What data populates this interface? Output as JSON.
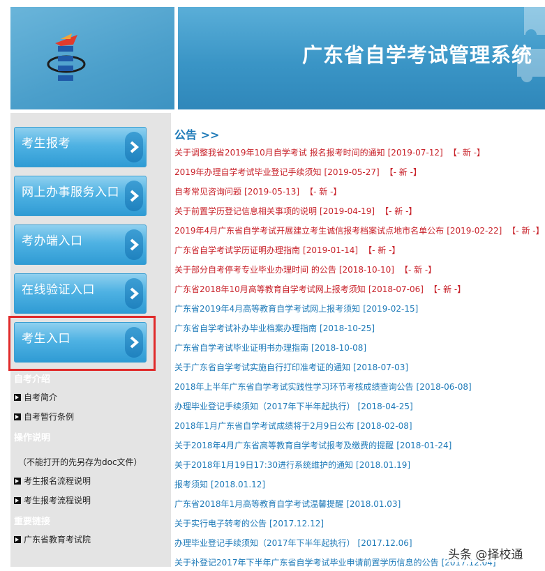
{
  "header": {
    "site_title": "广东省自学考试管理系统"
  },
  "nav": {
    "buttons": [
      {
        "label": "考生报考"
      },
      {
        "label": "网上办事服务入口"
      },
      {
        "label": "考办端入口"
      },
      {
        "label": "在线验证入口"
      },
      {
        "label": "考生入口"
      }
    ]
  },
  "sidebar": {
    "sections": [
      {
        "heading": "自考介绍",
        "links": [
          "自考简介",
          "自考暂行条例"
        ]
      },
      {
        "heading": "操作说明",
        "note": "（不能打开的先另存为doc文件）",
        "links": [
          "考生报名流程说明",
          "考生报考流程说明"
        ]
      },
      {
        "heading": "重要链接",
        "links": [
          "广东省教育考试院"
        ]
      }
    ]
  },
  "notices": {
    "title": "公告 >>",
    "new_tag": "【- 新 -】",
    "items": [
      {
        "text": "关于调整我省2019年10月自学考试 报名报考时间的通知",
        "date": "[2019-07-12]",
        "is_new": true
      },
      {
        "text": "2019年办理自学考试毕业登记手续须知",
        "date": "[2019-05-27]",
        "is_new": true
      },
      {
        "text": "自考常见咨询问题",
        "date": "[2019-05-13]",
        "is_new": true
      },
      {
        "text": "关于前置学历登记信息相关事项的说明",
        "date": "[2019-04-19]",
        "is_new": true
      },
      {
        "text": "2019年4月广东省自学考试开展建立考生诚信报考档案试点地市名单公布",
        "date": "[2019-02-22]",
        "is_new": true
      },
      {
        "text": "广东省自学考试学历证明办理指南",
        "date": "[2019-01-14]",
        "is_new": true
      },
      {
        "text": "关于部分自考停考专业毕业办理时间 的公告",
        "date": "[2018-10-10]",
        "is_new": true
      },
      {
        "text": "广东省2018年10月高等教育自学考试网上报考须知",
        "date": "[2018-07-06]",
        "is_new": true
      },
      {
        "text": "广东省2019年4月高等教育自学考试网上报考须知",
        "date": "[2019-02-15]",
        "is_new": false
      },
      {
        "text": "广东省自学考试补办毕业档案办理指南",
        "date": "[2018-10-25]",
        "is_new": false
      },
      {
        "text": "广东省自学考试毕业证明书办理指南",
        "date": "[2018-10-08]",
        "is_new": false
      },
      {
        "text": "关于广东省自学考试实施自行打印准考证的通知",
        "date": "[2018-07-03]",
        "is_new": false
      },
      {
        "text": "2018年上半年广东省自学考试实践性学习环节考核成绩查询公告",
        "date": "[2018-06-08]",
        "is_new": false
      },
      {
        "text": "办理毕业登记手续须知（2017年下半年起执行）",
        "date": "[2018-04-25]",
        "is_new": false
      },
      {
        "text": "2018年1月广东省自学考试成绩将于2月9日公布",
        "date": "[2018-02-08]",
        "is_new": false
      },
      {
        "text": "关于2018年4月广东省高等教育自学考试报考及缴费的提醒",
        "date": "[2018-01-24]",
        "is_new": false
      },
      {
        "text": "关于2018年1月19日17:30进行系统维护的通知",
        "date": "[2018.01.19]",
        "is_new": false
      },
      {
        "text": "报考须知",
        "date": "[2018.01.12]",
        "is_new": false
      },
      {
        "text": "广东省2018年1月高等教育自学考试温馨提醒",
        "date": "[2018.01.03]",
        "is_new": false
      },
      {
        "text": "关于实行电子转考的公告",
        "date": "[2017.12.12]",
        "is_new": false
      },
      {
        "text": "办理毕业登记手续须知（2017年下半年起执行）",
        "date": "[2017.12.06]",
        "is_new": false
      },
      {
        "text": "关于补登记2017年下半年广东省自学考试毕业申请前置学历信息的公告",
        "date": "[2017.12.04]",
        "is_new": false
      }
    ]
  },
  "watermark": {
    "text": "头条 @择校通"
  },
  "colors": {
    "new": "#c8222a",
    "old": "#1e7ab8",
    "nav": "#4fb2e3",
    "highlight": "#e02a2a"
  }
}
